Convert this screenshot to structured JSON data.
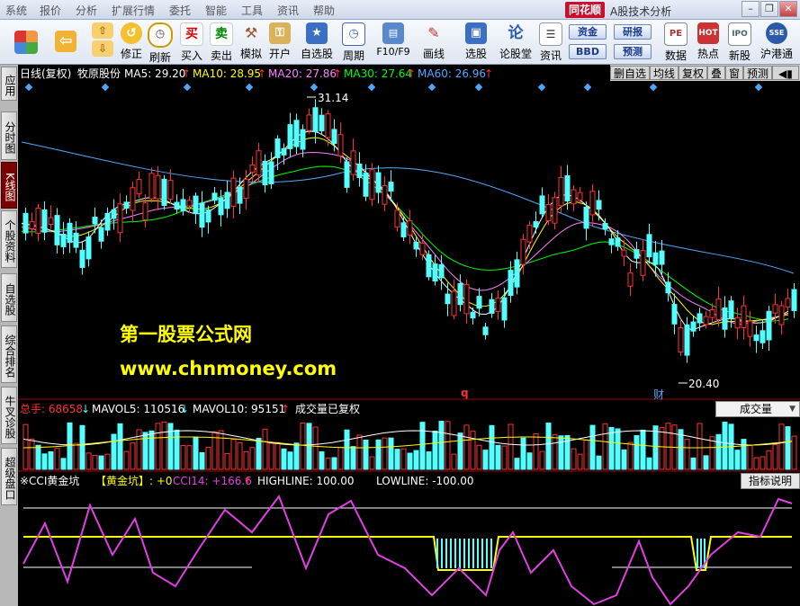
{
  "menu": [
    "系统",
    "报价",
    "分析",
    "扩展行情",
    "委托",
    "智能",
    "工具",
    "资讯",
    "帮助"
  ],
  "brand": "同花顺",
  "app_title": "A股技术分析",
  "toolbar": {
    "buttons": [
      "修正",
      "刷新",
      "买入",
      "卖出",
      "模拟",
      "开户",
      "自选股",
      "周期",
      "F10/F9",
      "画线",
      "选股",
      "论股堂",
      "资讯",
      "数据",
      "热点",
      "新股",
      "沪港通"
    ],
    "right_buttons": [
      "资金",
      "研报",
      "BBD",
      "预测"
    ]
  },
  "left_tabs": [
    "应用",
    "分时图",
    "K线图",
    "个股资料",
    "自选股",
    "综合排名",
    "牛叉诊股",
    "超级盘口"
  ],
  "kline": {
    "period_label": "日线(复权)",
    "stock": "牧原股份",
    "ma5": "MA5: 29.20",
    "ma10": "MA10: 28.95",
    "ma20": "MA20: 27.86",
    "ma30": "MA30: 27.64",
    "ma60": "MA60: 26.96",
    "high_label": "31.14",
    "low_label": "20.40",
    "marker_q": "q",
    "marker_cai": "财",
    "tools": [
      "删自选",
      "均线",
      "复权",
      "叠",
      "窗",
      "预测"
    ]
  },
  "watermark": {
    "line1": "第一股票公式网",
    "line2": "www.chnmoney.com"
  },
  "volume": {
    "zongshou": "总手: 68658",
    "mavol5": "MAVOL5: 110516",
    "mavol10": "MAVOL10: 95151",
    "note": "成交量已复权",
    "selector": "成交量"
  },
  "indicator": {
    "name": "※CCI黄金坑",
    "sub": "【黄金坑】: +0",
    "cci": "CCI14: +166.6",
    "highline": "HIGHLINE: 100.00",
    "lowline": "LOWLINE: -100.00",
    "help": "指标说明"
  },
  "colors": {
    "up": "#ff3232",
    "down": "#54ffff",
    "ma5": "#ffffff",
    "ma10": "#ffff00",
    "ma20": "#ff80ff",
    "ma30": "#00ff00",
    "ma60": "#54a8ff",
    "cci": "#e040e0",
    "brand": "#c8102e"
  }
}
